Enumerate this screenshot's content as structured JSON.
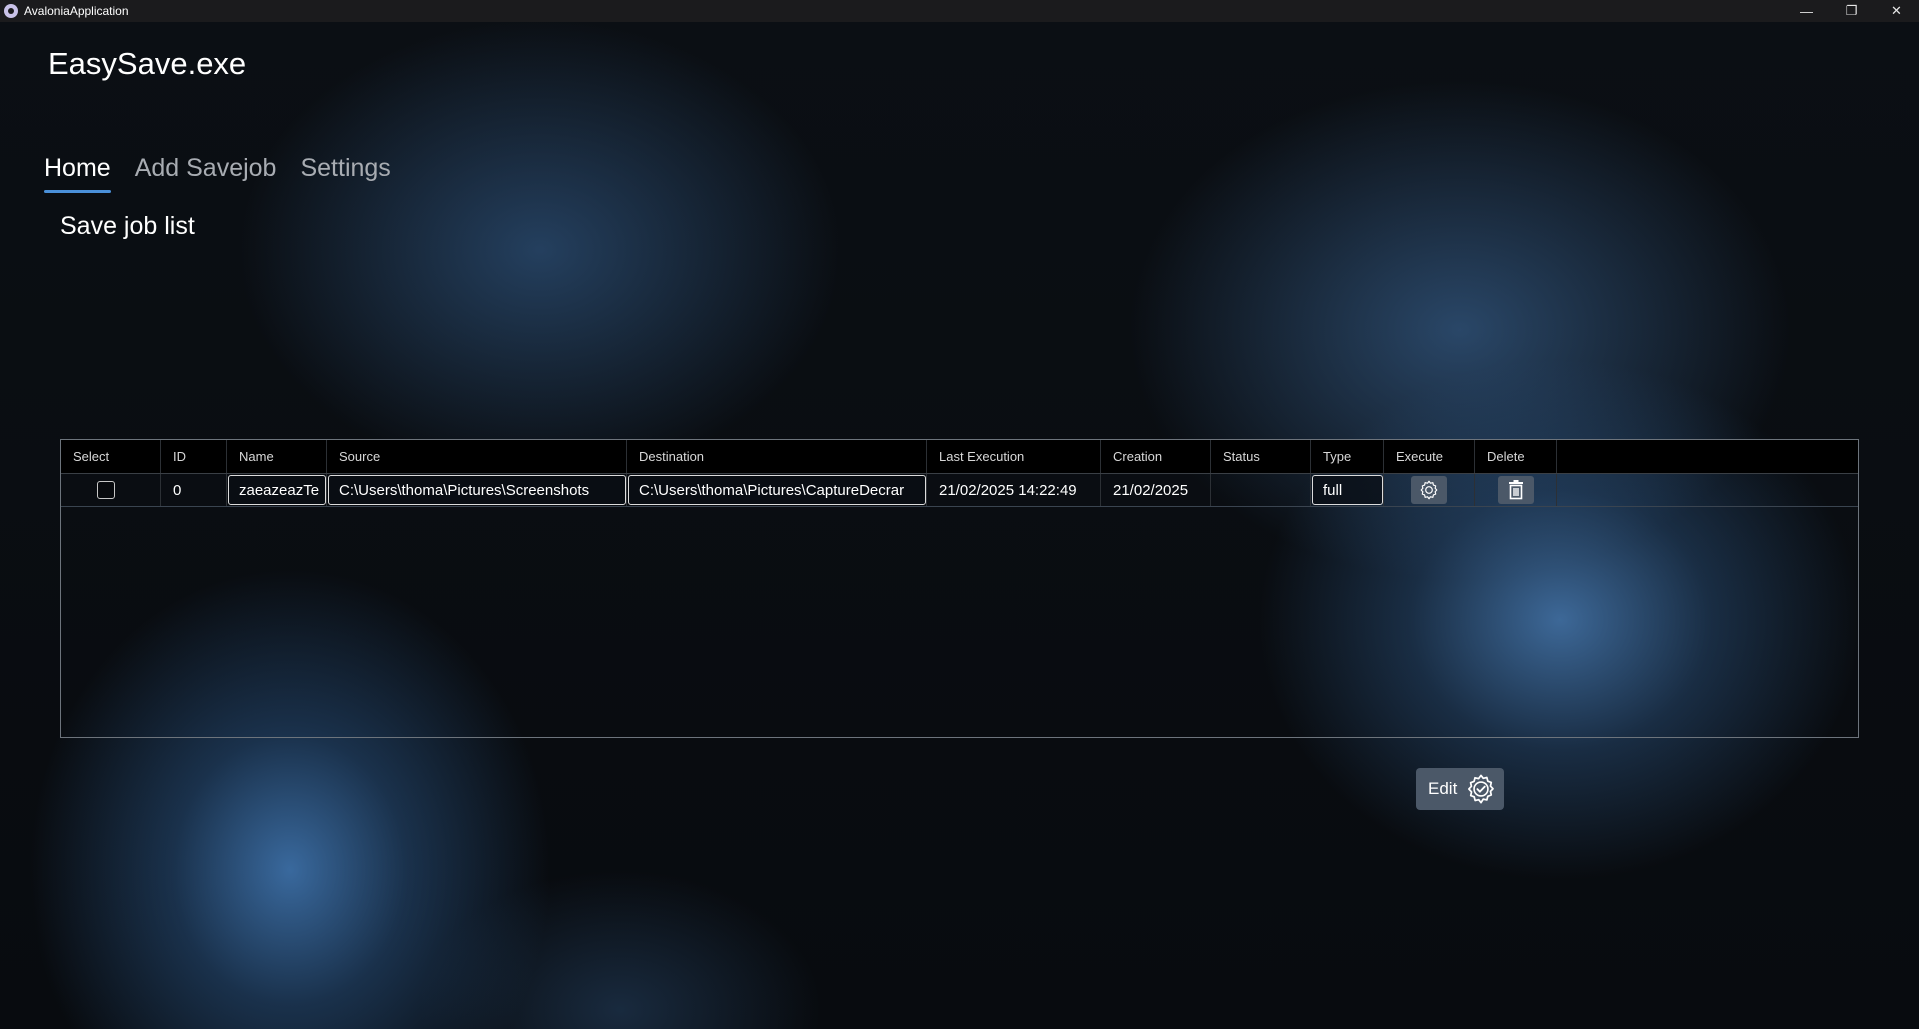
{
  "window": {
    "title": "AvaloniaApplication",
    "controls": {
      "minimize": "—",
      "restore": "❐",
      "close": "✕"
    }
  },
  "app": {
    "title": "EasySave.exe"
  },
  "nav": {
    "tabs": [
      {
        "label": "Home",
        "active": true
      },
      {
        "label": "Add Savejob",
        "active": false
      },
      {
        "label": "Settings",
        "active": false
      }
    ]
  },
  "page": {
    "section_title": "Save job list"
  },
  "grid": {
    "columns": [
      "Select",
      "ID",
      "Name",
      "Source",
      "Destination",
      "Last Execution",
      "Creation",
      "Status",
      "Type",
      "Execute",
      "Delete"
    ],
    "rows": [
      {
        "selected": false,
        "id": "0",
        "name": "zaeazeazTe",
        "source": "C:\\Users\\thoma\\Pictures\\Screenshots",
        "destination": "C:\\Users\\thoma\\Pictures\\CaptureDecrar",
        "last_execution": "21/02/2025 14:22:49",
        "creation": "21/02/2025",
        "status": "",
        "type": "full",
        "execute_icon": "gear-icon",
        "delete_icon": "trash-icon"
      }
    ]
  },
  "actions": {
    "edit_label": "Edit",
    "edit_icon": "gear-check-icon"
  },
  "colors": {
    "accent": "#4a90d9",
    "button_bg": "#4b5868",
    "header_bg": "#000000",
    "background": "#080b0f"
  }
}
